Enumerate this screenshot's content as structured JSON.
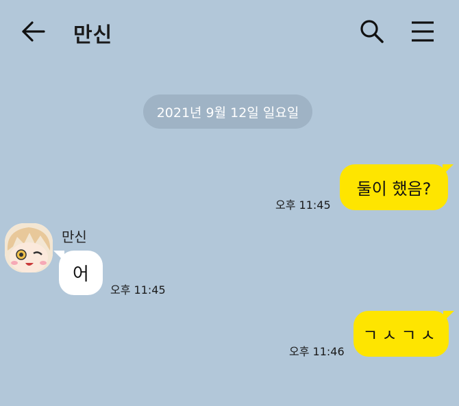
{
  "header": {
    "title": "만신",
    "back_icon": "arrow-left-icon",
    "search_icon": "search-icon",
    "menu_icon": "hamburger-menu-icon"
  },
  "date_divider": "2021년 9월 12일 일요일",
  "messages": [
    {
      "from": "me",
      "text": "둘이 했음?",
      "time": "오후 11:45"
    },
    {
      "from": "them",
      "sender": "만신",
      "text": "어",
      "time": "오후 11:45"
    },
    {
      "from": "me",
      "text": "ㄱㅅㄱㅅ",
      "time": "오후 11:46"
    }
  ],
  "colors": {
    "background": "#b2c7d9",
    "my_bubble": "#fee500",
    "their_bubble": "#ffffff",
    "date_pill": "#9fb3c5"
  }
}
